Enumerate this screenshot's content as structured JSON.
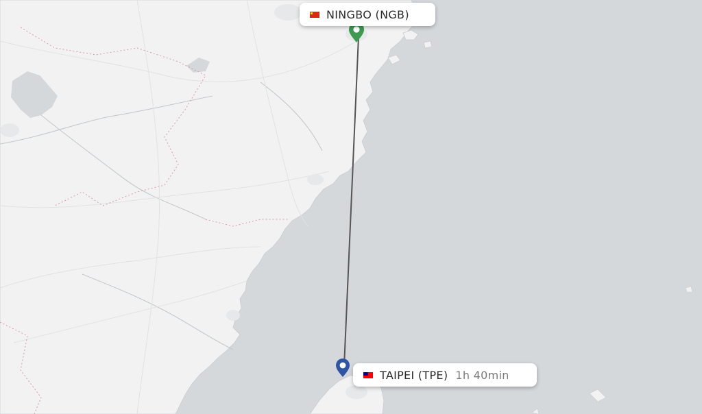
{
  "map": {
    "land_color": "#f2f2f2",
    "sea_color": "#d4d8db",
    "route_color": "#555555"
  },
  "origin": {
    "label": "NINGBO (NGB)",
    "flag_icon": "china-flag-icon",
    "pin_color": "#3d9a4f",
    "pin_icon": "origin-pin-icon"
  },
  "destination": {
    "label": "TAIPEI (TPE)",
    "duration": "1h 40min",
    "flag_icon": "taiwan-flag-icon",
    "pin_color": "#2f55a4",
    "pin_icon": "destination-pin-icon"
  }
}
